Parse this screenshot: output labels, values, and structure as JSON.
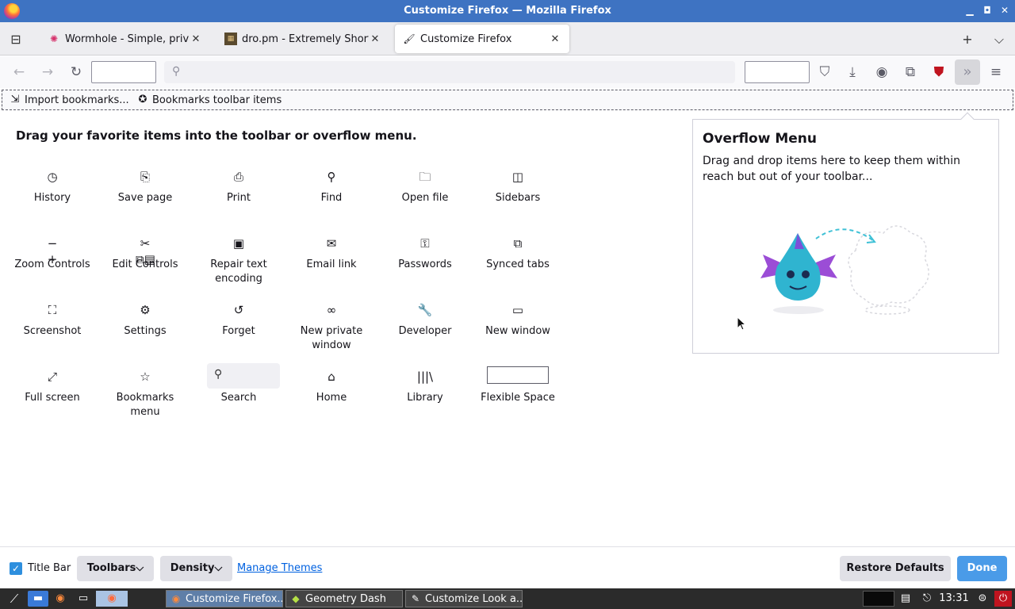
{
  "window": {
    "title": "Customize Firefox — Mozilla Firefox",
    "minimize_glyph": "▁",
    "maximize_glyph": "◘",
    "close_glyph": "✕"
  },
  "tabs": [
    {
      "label": "Wormhole - Simple, privat",
      "close": "✕"
    },
    {
      "label": "dro.pm - Extremely Short I",
      "close": "✕"
    },
    {
      "label": "Customize Firefox",
      "close": "✕"
    }
  ],
  "tabbar": {
    "new_tab": "+",
    "list_all": "⌵"
  },
  "palette": {
    "heading": "Drag your favorite items into the toolbar or overflow menu.",
    "items": [
      {
        "label": "History",
        "icon": "clock-icon",
        "glyph": "◷"
      },
      {
        "label": "Save page",
        "icon": "save-page-icon",
        "glyph": "⎘"
      },
      {
        "label": "Print",
        "icon": "printer-icon",
        "glyph": "⎙"
      },
      {
        "label": "Find",
        "icon": "magnifier-icon",
        "glyph": "⚲"
      },
      {
        "label": "Open file",
        "icon": "folder-icon",
        "glyph": "🗀"
      },
      {
        "label": "Sidebars",
        "icon": "sidebar-icon",
        "glyph": "◫"
      },
      {
        "label": "Zoom Controls",
        "icon": "zoom-icon",
        "glyph": "− +"
      },
      {
        "label": "Edit Controls",
        "icon": "edit-controls-icon",
        "glyph": "✂⧉▤"
      },
      {
        "label": "Repair text encoding",
        "icon": "text-encoding-icon",
        "glyph": "▣"
      },
      {
        "label": "Email link",
        "icon": "envelope-icon",
        "glyph": "✉"
      },
      {
        "label": "Passwords",
        "icon": "key-icon",
        "glyph": "⚿"
      },
      {
        "label": "Synced tabs",
        "icon": "synced-tabs-icon",
        "glyph": "⧉"
      },
      {
        "label": "Screenshot",
        "icon": "screenshot-icon",
        "glyph": "⛶"
      },
      {
        "label": "Settings",
        "icon": "gear-icon",
        "glyph": "⚙"
      },
      {
        "label": "Forget",
        "icon": "forget-icon",
        "glyph": "↺"
      },
      {
        "label": "New private window",
        "icon": "private-mask-icon",
        "glyph": "∞"
      },
      {
        "label": "Developer",
        "icon": "wrench-icon",
        "glyph": "🔧"
      },
      {
        "label": "New window",
        "icon": "window-icon",
        "glyph": "▭"
      },
      {
        "label": "Full screen",
        "icon": "fullscreen-icon",
        "glyph": "⤢"
      },
      {
        "label": "Bookmarks menu",
        "icon": "bookmark-star-icon",
        "glyph": "☆"
      },
      {
        "label": "Search",
        "icon": "search-icon",
        "glyph": ""
      },
      {
        "label": "Home",
        "icon": "home-icon",
        "glyph": "⌂"
      },
      {
        "label": "Library",
        "icon": "library-icon",
        "glyph": "|||\\"
      },
      {
        "label": "Flexible Space",
        "icon": "flexible-space-icon",
        "glyph": ""
      }
    ]
  },
  "bookmarks_bar": {
    "import_label": "Import bookmarks...",
    "toolbar_items_label": "Bookmarks toolbar items"
  },
  "overflow_panel": {
    "title": "Overflow Menu",
    "description": "Drag and drop items here to keep them within reach but out of your toolbar..."
  },
  "customize_bar": {
    "title_bar_label": "Title Bar",
    "toolbars_label": "Toolbars",
    "density_label": "Density",
    "manage_themes_label": "Manage Themes",
    "restore_label": "Restore Defaults",
    "done_label": "Done"
  },
  "taskbar": {
    "tasks": [
      {
        "label": "Customize Firefox..."
      },
      {
        "label": "Geometry Dash"
      },
      {
        "label": "Customize Look a..."
      }
    ],
    "clock": "13:31"
  },
  "colors": {
    "titlebar": "#3e73c2",
    "accent": "#2e8fde",
    "link": "#0061e0"
  }
}
